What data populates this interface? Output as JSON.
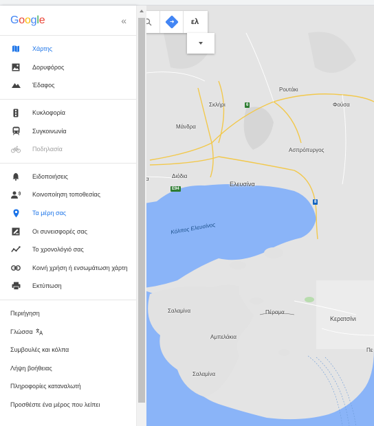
{
  "sidebar": {
    "logo": "Google",
    "collapse_label": "«",
    "map_types": [
      {
        "label": "Χάρτης",
        "icon": "map-icon",
        "active": true
      },
      {
        "label": "Δορυφόρος",
        "icon": "satellite-icon"
      },
      {
        "label": "Έδαφος",
        "icon": "terrain-icon"
      }
    ],
    "layers": [
      {
        "label": "Κυκλοφορία",
        "icon": "traffic-icon"
      },
      {
        "label": "Συγκοινωνία",
        "icon": "transit-icon"
      },
      {
        "label": "Ποδηλασία",
        "icon": "bicycle-icon",
        "disabled": true
      }
    ],
    "personal": [
      {
        "label": "Ειδοποιήσεις",
        "icon": "bell-icon"
      },
      {
        "label": "Κοινοποίηση τοποθεσίας",
        "icon": "location-share-icon"
      },
      {
        "label": "Τα μέρη σας",
        "icon": "pin-icon",
        "active": true
      },
      {
        "label": "Οι συνεισφορές σας",
        "icon": "contributions-icon"
      },
      {
        "label": "Το χρονολόγιό σας",
        "icon": "timeline-icon"
      },
      {
        "label": "Κοινή χρήση ή ενσωμάτωση χάρτη",
        "icon": "link-icon"
      },
      {
        "label": "Εκτύπωση",
        "icon": "print-icon"
      }
    ],
    "footer": [
      {
        "label": "Περιήγηση"
      },
      {
        "label": "Γλώσσα",
        "icon": "translate-icon"
      },
      {
        "label": "Συμβουλές και κόλπα"
      },
      {
        "label": "Λήψη βοήθειας"
      },
      {
        "label": "Πληροφορίες καταναλωτή"
      },
      {
        "label": "Προσθέστε ένα μέρος που λείπει"
      }
    ]
  },
  "map": {
    "language_button": "ελ",
    "places": [
      {
        "key": "roytaki",
        "label": "Ρουτάκι"
      },
      {
        "key": "sklhri",
        "label": "Σκλήρι"
      },
      {
        "key": "fousa",
        "label": "Φούσα"
      },
      {
        "key": "mandra",
        "label": "Μάνδρα"
      },
      {
        "key": "aspropyrgos",
        "label": "Ασπρόπυργος"
      },
      {
        "key": "diodia",
        "label": "Διόδια"
      },
      {
        "key": "eleusina",
        "label": "Ελευσίνα"
      },
      {
        "key": "salamina1",
        "label": "Σαλαμίνα"
      },
      {
        "key": "perama",
        "label": "Πέραμα"
      },
      {
        "key": "keratsini",
        "label": "Κερατσίνι"
      },
      {
        "key": "ampelakia",
        "label": "Αμπελάκια"
      },
      {
        "key": "salamina2",
        "label": "Σαλαμίνα"
      },
      {
        "key": "pe",
        "label": "Πε"
      },
      {
        "key": "gulf",
        "label": "Κόλπος Ελευσίνος"
      },
      {
        "key": "sa",
        "label": "α"
      }
    ],
    "shields": [
      {
        "key": "s6",
        "label": "6"
      },
      {
        "key": "e94",
        "label": "E94"
      },
      {
        "key": "s8",
        "label": "8"
      }
    ],
    "colors": {
      "water": "#8ab4f8",
      "land": "#e6e6e6",
      "road": "#f2c84b",
      "shield_green": "#2e7d32",
      "shield_blue": "#1565c0",
      "accent": "#1a73e8"
    }
  }
}
